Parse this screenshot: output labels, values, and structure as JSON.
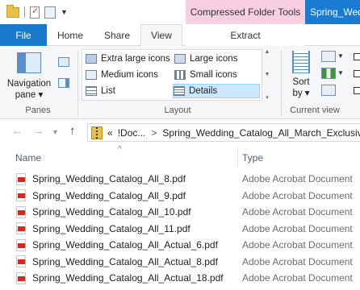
{
  "titlebar": {
    "contextual_tab_group": "Compressed Folder Tools",
    "window_title": "Spring_Wedding"
  },
  "tabs": [
    {
      "label": "File"
    },
    {
      "label": "Home"
    },
    {
      "label": "Share"
    },
    {
      "label": "View"
    },
    {
      "label": "Extract"
    }
  ],
  "ribbon": {
    "panes": {
      "navigation_pane_line1": "Navigation",
      "navigation_pane_line2": "pane ▾",
      "group_label": "Panes"
    },
    "layout": {
      "group_label": "Layout",
      "options": [
        {
          "label": "Extra large icons",
          "icon": "extra-large-icons-icon"
        },
        {
          "label": "Large icons",
          "icon": "large-icons-icon"
        },
        {
          "label": "Medium icons",
          "icon": "medium-icons-icon"
        },
        {
          "label": "Small icons",
          "icon": "small-icons-icon"
        },
        {
          "label": "List",
          "icon": "list-icon"
        },
        {
          "label": "Details",
          "icon": "details-icon"
        }
      ],
      "selected": "Details"
    },
    "current_view": {
      "sort_line1": "Sort",
      "sort_line2": "by ▾",
      "group_label": "Current view"
    }
  },
  "address": {
    "overflow": "«",
    "crumbs": [
      "!Doc...",
      "Spring_Wedding_Catalog_All_March_Exclusives"
    ]
  },
  "columns": {
    "name": "Name",
    "type": "Type"
  },
  "files": [
    {
      "name": "Spring_Wedding_Catalog_All_8.pdf",
      "type": "Adobe Acrobat Document"
    },
    {
      "name": "Spring_Wedding_Catalog_All_9.pdf",
      "type": "Adobe Acrobat Document"
    },
    {
      "name": "Spring_Wedding_Catalog_All_10.pdf",
      "type": "Adobe Acrobat Document"
    },
    {
      "name": "Spring_Wedding_Catalog_All_11.pdf",
      "type": "Adobe Acrobat Document"
    },
    {
      "name": "Spring_Wedding_Catalog_All_Actual_6.pdf",
      "type": "Adobe Acrobat Document"
    },
    {
      "name": "Spring_Wedding_Catalog_All_Actual_8.pdf",
      "type": "Adobe Acrobat Document"
    },
    {
      "name": "Spring_Wedding_Catalog_All_Actual_18.pdf",
      "type": "Adobe Acrobat Document"
    }
  ],
  "colors": {
    "file_tab": "#1979ca",
    "contextual_tab": "#f7cfe0",
    "selected_layout": "#cce8ff"
  }
}
